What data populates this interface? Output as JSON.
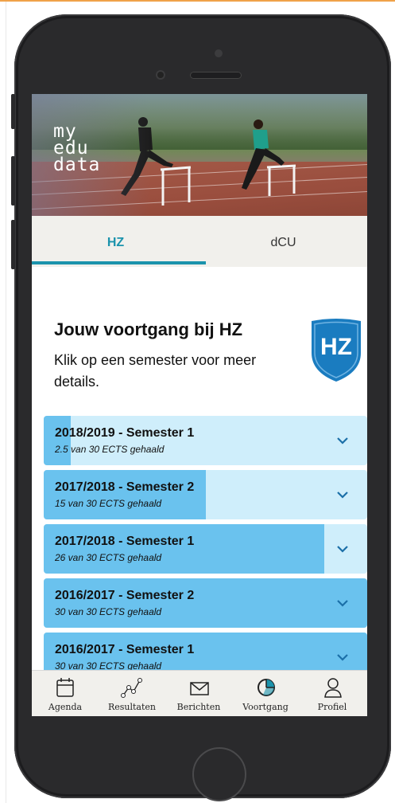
{
  "app": {
    "logo_lines": [
      "my",
      "edu",
      "data"
    ]
  },
  "tabs": [
    {
      "label": "HZ",
      "active": true
    },
    {
      "label": "dCU",
      "active": false
    }
  ],
  "header": {
    "title": "Jouw voortgang bij HZ",
    "subtitle": "Klik op een semester voor meer details.",
    "badge_icon": "hz-shield-icon",
    "badge_text": "HZ"
  },
  "semesters": [
    {
      "name": "2018/2019 - Semester 1",
      "progress": "2.5 van 30 ECTS gehaald",
      "earned": 2.5,
      "total": 30
    },
    {
      "name": "2017/2018 - Semester 2",
      "progress": "15 van 30 ECTS gehaald",
      "earned": 15,
      "total": 30
    },
    {
      "name": "2017/2018 - Semester 1",
      "progress": "26 van 30 ECTS gehaald",
      "earned": 26,
      "total": 30
    },
    {
      "name": "2016/2017 - Semester 2",
      "progress": "30 van 30 ECTS gehaald",
      "earned": 30,
      "total": 30
    },
    {
      "name": "2016/2017 - Semester 1",
      "progress": "30 van 30 ECTS gehaald",
      "earned": 30,
      "total": 30
    }
  ],
  "bottom_nav": [
    {
      "label": "Agenda",
      "icon": "calendar-icon"
    },
    {
      "label": "Resultaten",
      "icon": "chart-line-icon"
    },
    {
      "label": "Berichten",
      "icon": "envelope-icon"
    },
    {
      "label": "Voortgang",
      "icon": "pie-chart-icon",
      "active": true
    },
    {
      "label": "Profiel",
      "icon": "person-icon"
    }
  ],
  "colors": {
    "accent": "#1b93ac",
    "progress_fill": "#6ac2ee",
    "progress_track": "#cfeefb",
    "shield": "#1a7cc0"
  }
}
